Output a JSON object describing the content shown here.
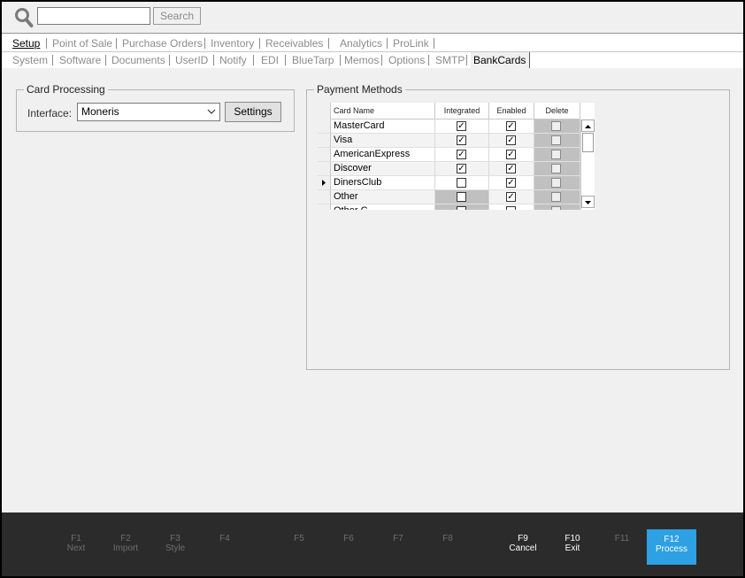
{
  "search": {
    "input_value": "",
    "button_label": "Search"
  },
  "main_menu": [
    {
      "label": "Setup",
      "active": true
    },
    {
      "label": "Point of Sale"
    },
    {
      "label": "Purchase Orders"
    },
    {
      "label": "Inventory"
    },
    {
      "label": "Receivables"
    },
    {
      "label": "Analytics"
    },
    {
      "label": "ProLink"
    }
  ],
  "sub_menu": [
    {
      "label": "System"
    },
    {
      "label": "Software"
    },
    {
      "label": "Documents"
    },
    {
      "label": "UserID"
    },
    {
      "label": "Notify"
    },
    {
      "label": "EDI"
    },
    {
      "label": "BlueTarp"
    },
    {
      "label": "Memos"
    },
    {
      "label": "Options"
    },
    {
      "label": "SMTP"
    },
    {
      "label": "BankCards",
      "active": true
    }
  ],
  "card_processing": {
    "title": "Card Processing",
    "interface_label": "Interface:",
    "interface_value": "Moneris",
    "settings_label": "Settings"
  },
  "payment_methods": {
    "title": "Payment Methods",
    "columns": [
      "Card Name",
      "Integrated",
      "Enabled",
      "Delete"
    ],
    "rows": [
      {
        "name": "MasterCard",
        "integrated": true,
        "enabled": true,
        "delete": false
      },
      {
        "name": "Visa",
        "integrated": true,
        "enabled": true,
        "delete": false
      },
      {
        "name": "AmericanExpress",
        "integrated": true,
        "enabled": true,
        "delete": false
      },
      {
        "name": "Discover",
        "integrated": true,
        "enabled": true,
        "delete": false
      },
      {
        "name": "DinersClub",
        "integrated": false,
        "enabled": true,
        "delete": false,
        "current": true
      },
      {
        "name": "Other",
        "integrated": false,
        "enabled": true,
        "delete": false,
        "integrated_gray": true
      },
      {
        "name": "Other C...",
        "integrated": false,
        "enabled": false,
        "delete": false,
        "integrated_gray": true
      }
    ]
  },
  "footer": [
    {
      "key": "F1",
      "label": "Next"
    },
    {
      "key": "F2",
      "label": "Import"
    },
    {
      "key": "F3",
      "label": "Style"
    },
    {
      "key": "F4",
      "label": ""
    },
    {
      "key": "F5",
      "label": ""
    },
    {
      "key": "F6",
      "label": ""
    },
    {
      "key": "F7",
      "label": ""
    },
    {
      "key": "F8",
      "label": ""
    },
    {
      "key": "F9",
      "label": "Cancel",
      "enabled": true
    },
    {
      "key": "F10",
      "label": "Exit",
      "enabled": true
    },
    {
      "key": "F11",
      "label": ""
    },
    {
      "key": "F12",
      "label": "Process",
      "primary": true
    }
  ],
  "colors": {
    "footer_bg": "#2b2b2b",
    "primary_key": "#2ea0e4",
    "menu_inactive": "#8c8c8c"
  }
}
